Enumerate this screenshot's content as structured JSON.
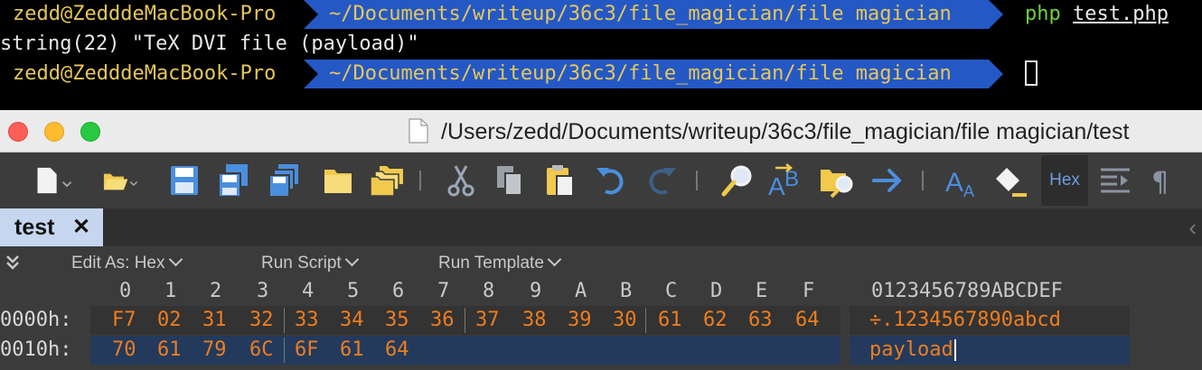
{
  "terminal": {
    "user_host": "zedd@ZedddeMacBook-Pro",
    "path": "~/Documents/writeup/36c3/file_magician/file magician",
    "command_name": "php",
    "command_arg": "test.php",
    "output": "string(22) \"TeX DVI file (payload)\""
  },
  "window": {
    "title": "/Users/zedd/Documents/writeup/36c3/file_magician/file magician/test"
  },
  "toolbar": {
    "hex_label": "Hex"
  },
  "tab": {
    "label": "test",
    "close": "✕"
  },
  "options": {
    "edit_as": "Edit As: Hex",
    "run_script": "Run Script",
    "run_template": "Run Template"
  },
  "hex": {
    "columns": [
      "0",
      "1",
      "2",
      "3",
      "4",
      "5",
      "6",
      "7",
      "8",
      "9",
      "A",
      "B",
      "C",
      "D",
      "E",
      "F"
    ],
    "ascii_header": "0123456789ABCDEF",
    "rows": [
      {
        "offset": "0000h:",
        "bytes": [
          "F7",
          "02",
          "31",
          "32",
          "33",
          "34",
          "35",
          "36",
          "37",
          "38",
          "39",
          "30",
          "61",
          "62",
          "63",
          "64"
        ],
        "ascii": "÷.1234567890abcd"
      },
      {
        "offset": "0010h:",
        "bytes": [
          "70",
          "61",
          "79",
          "6C",
          "6F",
          "61",
          "64"
        ],
        "ascii": "payload"
      }
    ]
  },
  "colors": {
    "prompt_user": "#e6c75a",
    "path_bg": "#2458c5",
    "hex_bytes": "#ee7d1f",
    "selection": "#233a5c"
  }
}
